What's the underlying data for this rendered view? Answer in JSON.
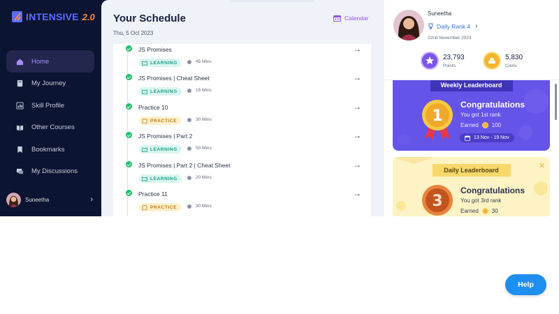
{
  "app": {
    "logo_text": "INTENSIVE",
    "logo_version": "2.0",
    "brand_color": "#5a6dff",
    "accent_color": "#8f55e8"
  },
  "sidebar": {
    "items": [
      {
        "label": "Home",
        "icon": "home-icon",
        "active": true
      },
      {
        "label": "My Journey",
        "icon": "journey-icon",
        "active": false
      },
      {
        "label": "Skill Profile",
        "icon": "skill-profile-icon",
        "active": false
      },
      {
        "label": "Other Courses",
        "icon": "courses-icon",
        "active": false
      },
      {
        "label": "Bookmarks",
        "icon": "bookmark-icon",
        "active": false
      },
      {
        "label": "My Discussions",
        "icon": "discussion-icon",
        "active": false
      }
    ],
    "user_name": "Suneetha"
  },
  "schedule": {
    "title": "Your Schedule",
    "date": "Thu, 5 Oct 2023",
    "calendar_label": "Calendar",
    "items": [
      {
        "title": "JS Promises",
        "type": "LEARNING",
        "duration": "45 Mins"
      },
      {
        "title": "JS Promises | Cheat Sheet",
        "type": "LEARNING",
        "duration": "15 Mins"
      },
      {
        "title": "Practice 10",
        "type": "PRACTICE",
        "duration": "30 Mins"
      },
      {
        "title": "JS Promises | Part 2",
        "type": "LEARNING",
        "duration": "50 Mins"
      },
      {
        "title": "JS Promises | Part 2 | Cheat Sheet",
        "type": "LEARNING",
        "duration": "20 Mins"
      },
      {
        "title": "Practice 11",
        "type": "PRACTICE",
        "duration": "30 Mins"
      }
    ]
  },
  "profile": {
    "name": "Suneetha",
    "rank": "Daily Rank 4",
    "date": "22nd November 2023",
    "points_value": "23,793",
    "points_label": "Points",
    "coins_value": "5,830",
    "coins_label": "Coins"
  },
  "weekly": {
    "title": "Weekly Leaderboard",
    "heading": "Congratulations",
    "subtitle": "You got 1st rank",
    "earned_label": "Earned",
    "earned_value": "100",
    "range": "13 Nov - 19 Nov",
    "medal_number": "1"
  },
  "daily": {
    "title": "Daily Leaderboard",
    "heading": "Congratulations",
    "subtitle": "You got 3rd rank",
    "earned_label": "Earned",
    "earned_value": "30",
    "medal_number": "3"
  },
  "help": {
    "label": "Help"
  }
}
